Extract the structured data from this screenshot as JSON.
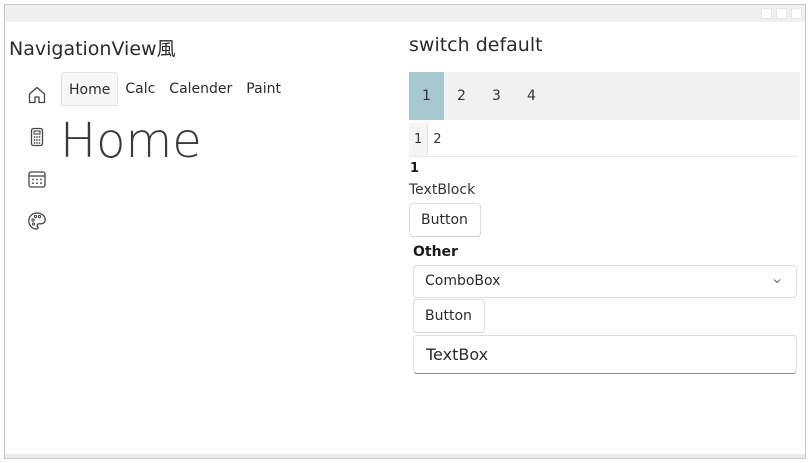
{
  "left_panel": {
    "title": "NavigationView風",
    "nav_icons": [
      "home-icon",
      "calculator-icon",
      "calendar-icon",
      "palette-icon"
    ],
    "tabs": [
      {
        "label": "Home",
        "selected": true
      },
      {
        "label": "Calc",
        "selected": false
      },
      {
        "label": "Calender",
        "selected": false
      },
      {
        "label": "Paint",
        "selected": false
      }
    ],
    "page_heading": "Home"
  },
  "right_panel": {
    "title": "switch default",
    "pivot": {
      "items": [
        "1",
        "2",
        "3",
        "4"
      ],
      "selected": "1",
      "selected_color": "#a7c8cf"
    },
    "sub_tabs": {
      "items": [
        "1",
        "2"
      ],
      "selected": "1"
    },
    "content": {
      "number": "1",
      "textblock": "TextBlock",
      "button_label": "Button"
    },
    "other": {
      "header": "Other",
      "combobox_value": "ComboBox",
      "button_label": "Button",
      "textbox_value": "TextBox"
    }
  }
}
